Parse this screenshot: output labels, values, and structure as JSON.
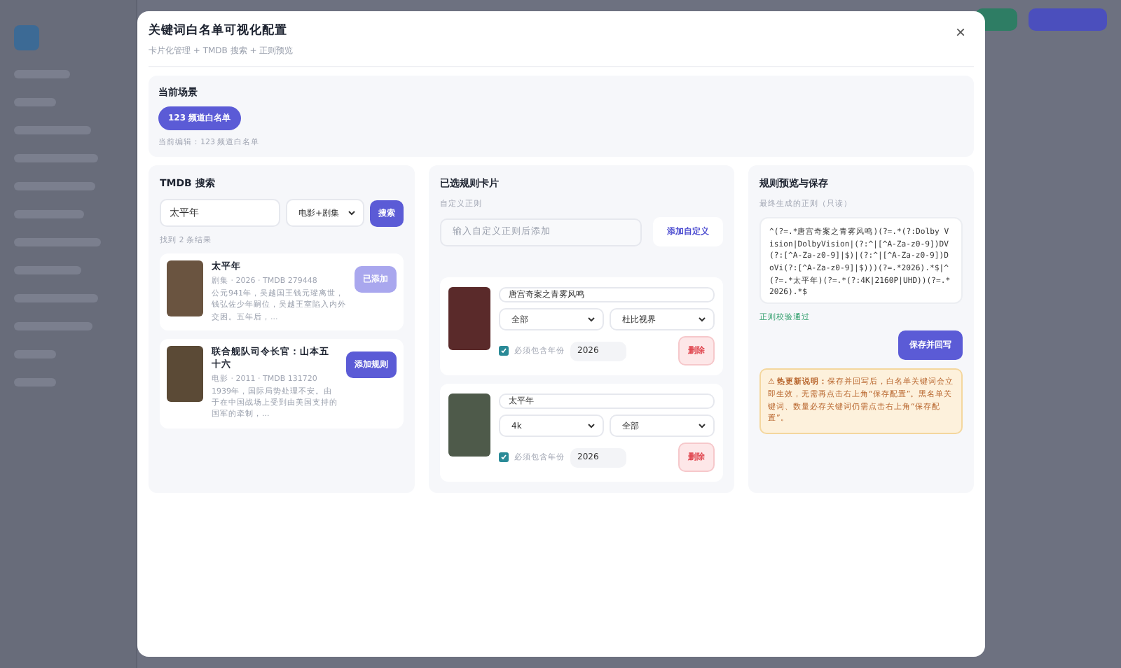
{
  "modal": {
    "title": "关键词白名单可视化配置",
    "subtitle": "卡片化管理 + TMDB 搜索 + 正则预览",
    "close": "×"
  },
  "scene": {
    "title": "当前场景",
    "chip": "123 频道白名单",
    "note": "当前编辑：123 频道白名单"
  },
  "search": {
    "title": "TMDB 搜索",
    "query": "太平年",
    "type": "电影+剧集",
    "button": "搜索",
    "count": "找到 2 条结果",
    "results": [
      {
        "title": "太平年",
        "meta": "剧集 · 2026 · TMDB 279448",
        "desc": "公元941年，吴越国王钱元瓘离世，钱弘佐少年嗣位，吴越王室陷入内外交困。五年后，...",
        "action": "已添加",
        "added": true
      },
      {
        "title": "联合舰队司令长官：山本五十六",
        "meta": "电影 · 2011 · TMDB 131720",
        "desc": "1939年，国际局势处理不安。由于在中国战场上受到由美国支持的国军的牵制，...",
        "action": "添加规则",
        "added": false
      }
    ]
  },
  "rules": {
    "title": "已选规则卡片",
    "label": "自定义正则",
    "placeholder": "输入自定义正则后添加",
    "add": "添加自定义",
    "cards": [
      {
        "name": "唐宫奇案之青雾风鸣",
        "quality": "全部",
        "hdr": "杜比视界",
        "require_year": true,
        "year_label": "必须包含年份",
        "year": "2026",
        "delete": "删除"
      },
      {
        "name": "太平年",
        "quality": "4k",
        "hdr": "全部",
        "require_year": true,
        "year_label": "必须包含年份",
        "year": "2026",
        "delete": "删除"
      }
    ]
  },
  "preview": {
    "title": "规则预览与保存",
    "label": "最终生成的正则（只读）",
    "regex": "^(?=.*唐宫奇案之青雾风鸣)(?=.*(?:Dolby Vision|DolbyVision|(?:^|[^A-Za-z0-9])DV(?:[^A-Za-z0-9]|$)|(?:^|[^A-Za-z0-9])DoVi(?:[^A-Za-z0-9]|$)))(?=.*2026).*$|^(?=.*太平年)(?=.*(?:4K|2160P|UHD))(?=.*2026).*$",
    "status": "正则校验通过",
    "save": "保存并回写",
    "notice": "⚠ **热更新说明：**保存并回写后，白名单关键词会立即生效，无需再点击右上角“保存配置”。黑名单关键词、数量必存关键词仍需点击右上角“保存配置”。"
  }
}
